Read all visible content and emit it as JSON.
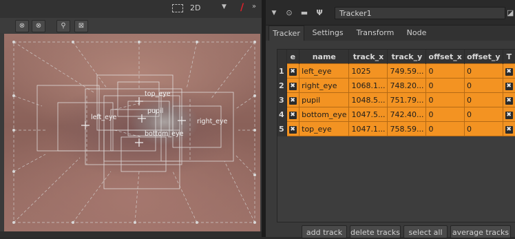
{
  "viewer": {
    "roi_icon": "roi-icon",
    "view_mode": "2D",
    "dropdown_icon": "chevron-down-icon",
    "pen_icon": "red-slash-icon",
    "overflow_icon": "double-chevron-icon",
    "toolbar_icons": [
      "previous-key-icon",
      "next-key-icon",
      "track-settings-icon",
      "transform-icon"
    ],
    "track_labels": {
      "top_eye": "top_eye",
      "pupil": "pupil",
      "left_eye": "left_eye",
      "right_eye": "right_eye",
      "bottom_eye": "bottom_eye"
    }
  },
  "node": {
    "name": "Tracker1",
    "icons": [
      "collapse-triangle-icon",
      "eye-icon",
      "clone-icon",
      "node-icon"
    ],
    "float_icon": "float-icon"
  },
  "tabs": [
    "Tracker",
    "Settings",
    "Transform",
    "Node"
  ],
  "active_tab": "Tracker",
  "table": {
    "columns": [
      "e",
      "name",
      "track_x",
      "track_y",
      "offset_x",
      "offset_y",
      "T"
    ],
    "rows": [
      {
        "n": "1",
        "name": "left_eye",
        "track_x": "1025",
        "track_y": "749.59...",
        "offset_x": "0",
        "offset_y": "0"
      },
      {
        "n": "2",
        "name": "right_eye",
        "track_x": "1068.1...",
        "track_y": "748.20...",
        "offset_x": "0",
        "offset_y": "0"
      },
      {
        "n": "3",
        "name": "pupil",
        "track_x": "1048.5...",
        "track_y": "751.79...",
        "offset_x": "0",
        "offset_y": "0"
      },
      {
        "n": "4",
        "name": "bottom_eye",
        "track_x": "1047.5...",
        "track_y": "742.40...",
        "offset_x": "0",
        "offset_y": "0"
      },
      {
        "n": "5",
        "name": "top_eye",
        "track_x": "1047.1...",
        "track_y": "758.59...",
        "offset_x": "0",
        "offset_y": "0"
      }
    ],
    "checkbox_glyph": "✖"
  },
  "buttons": {
    "add": "add track",
    "delete": "delete tracks",
    "select_all": "select all",
    "average": "average tracks"
  },
  "colors": {
    "row_highlight": "#f39322",
    "accent_red": "#e0202a"
  }
}
